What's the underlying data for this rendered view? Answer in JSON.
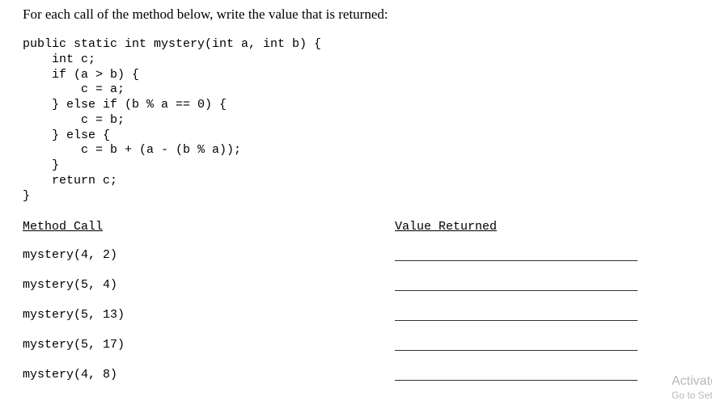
{
  "instruction": "For each call of the method below, write the value that is returned:",
  "code": "public static int mystery(int a, int b) {\n    int c;\n    if (a > b) {\n        c = a;\n    } else if (b % a == 0) {\n        c = b;\n    } else {\n        c = b + (a - (b % a));\n    }\n    return c;\n}",
  "headers": {
    "left": "Method Call",
    "right": "Value Returned"
  },
  "calls": [
    "mystery(4, 2)",
    "mystery(5, 4)",
    "mystery(5, 13)",
    "mystery(5, 17)",
    "mystery(4, 8)"
  ],
  "watermark": {
    "line1": "Activate Windows",
    "line2": "Go to Settings to activate Windows."
  }
}
